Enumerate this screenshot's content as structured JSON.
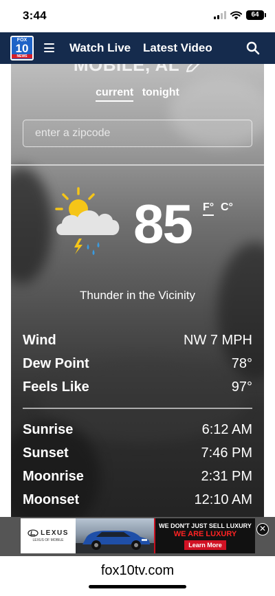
{
  "status_bar": {
    "time": "3:44",
    "battery": "64"
  },
  "nav": {
    "logo": {
      "top": "FOX",
      "number": "10",
      "bottom": "NEWS"
    },
    "links": [
      "Watch Live",
      "Latest Video"
    ]
  },
  "weather": {
    "city": "MOBILE, AL",
    "tabs": [
      {
        "label": "current",
        "active": true
      },
      {
        "label": "tonight",
        "active": false
      }
    ],
    "zip_placeholder": "enter a zipcode",
    "temperature": "85",
    "units": {
      "f": "F°",
      "c": "C°",
      "selected": "F°"
    },
    "condition": "Thunder in the Vicinity",
    "icon": "partly-cloudy-thunderstorm-icon",
    "stats": [
      {
        "label": "Wind",
        "value": "NW 7 MPH"
      },
      {
        "label": "Dew Point",
        "value": "78°"
      },
      {
        "label": "Feels Like",
        "value": "97°"
      }
    ],
    "astro": [
      {
        "label": "Sunrise",
        "value": "6:12 AM"
      },
      {
        "label": "Sunset",
        "value": "7:46 PM"
      },
      {
        "label": "Moonrise",
        "value": "2:31 PM"
      },
      {
        "label": "Moonset",
        "value": "12:10 AM"
      }
    ]
  },
  "ad": {
    "brand": "LEXUS",
    "dealer": "LEXUS OF MOBILE",
    "line1": "WE DON'T JUST SELL LUXURY",
    "line2": "WE ARE LUXURY",
    "cta": "Learn More"
  },
  "browser": {
    "url": "fox10tv.com"
  },
  "colors": {
    "navbar": "#152b4d",
    "accent_red": "#d11224",
    "logo_blue": "#1e63c7"
  }
}
